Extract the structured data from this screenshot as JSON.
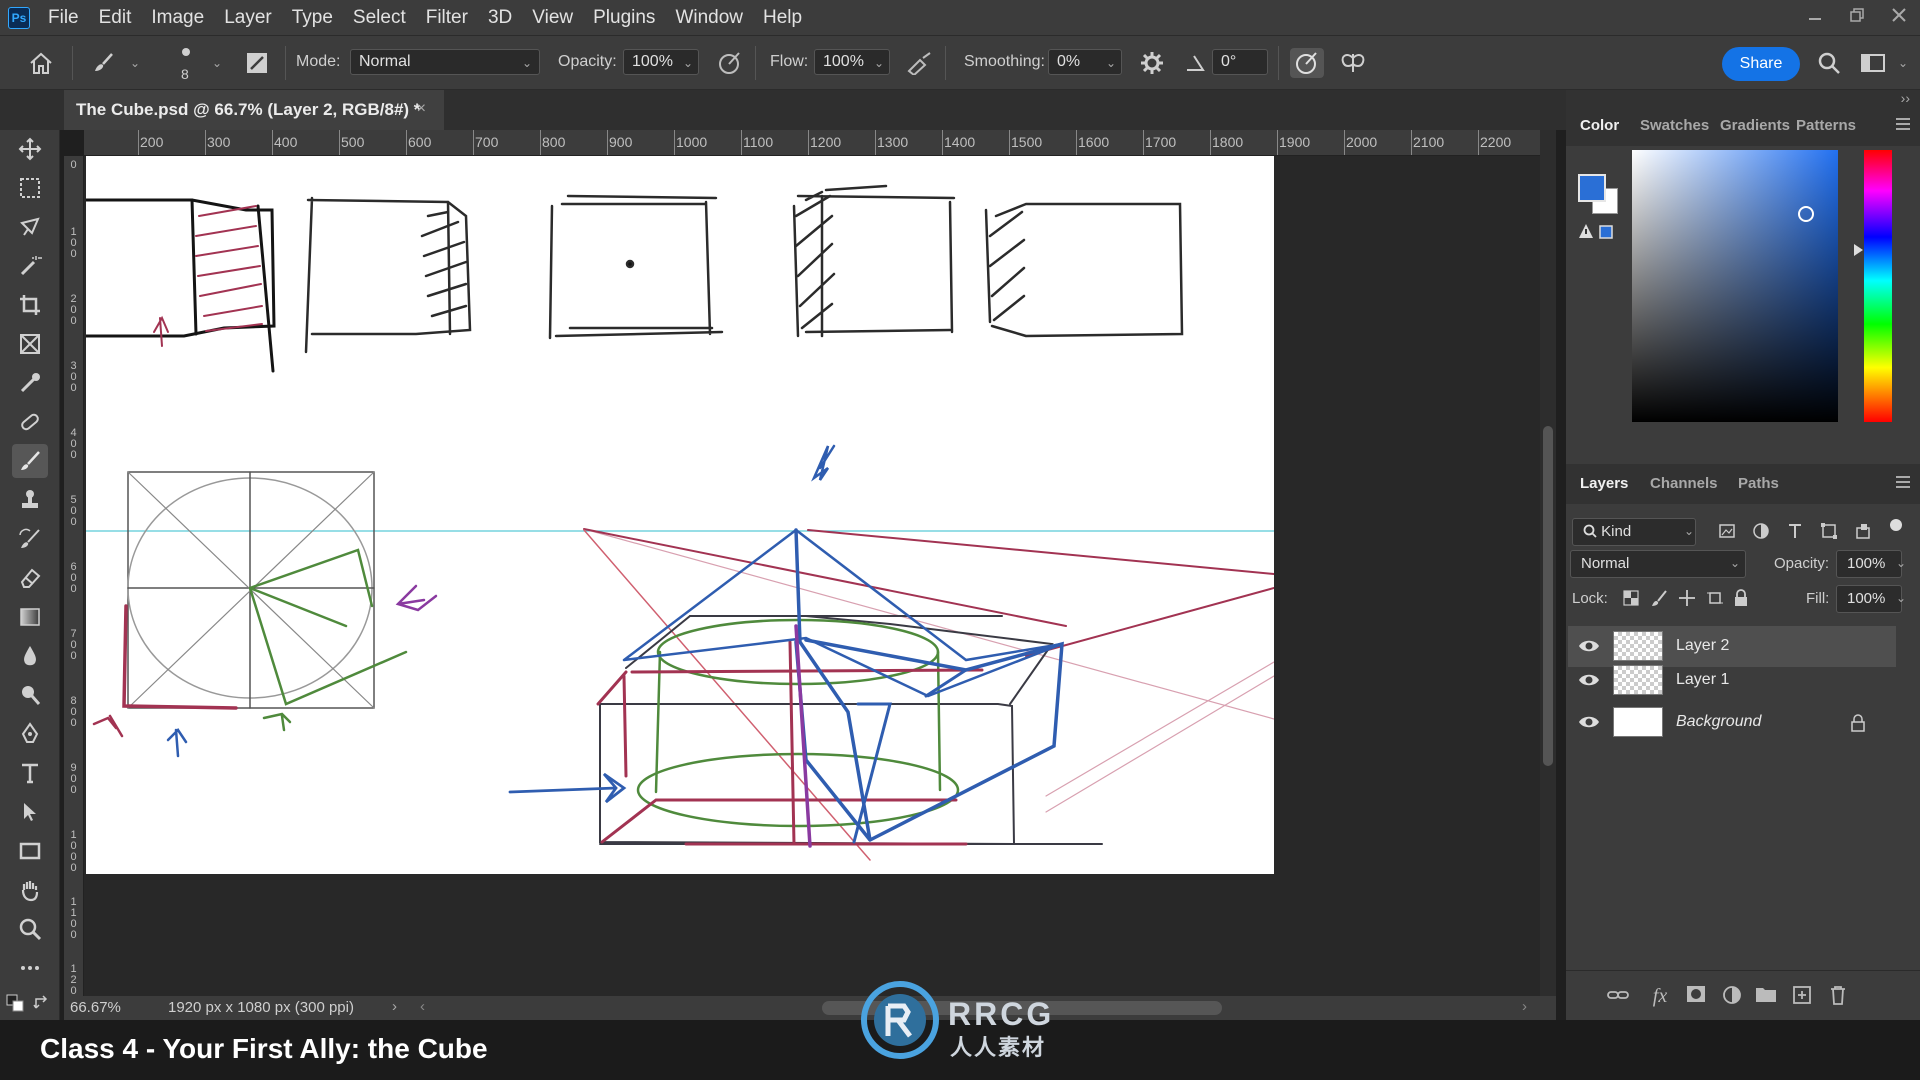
{
  "menubar": {
    "app_logo": "Ps",
    "items": [
      "File",
      "Edit",
      "Image",
      "Layer",
      "Type",
      "Select",
      "Filter",
      "3D",
      "View",
      "Plugins",
      "Window",
      "Help"
    ]
  },
  "options": {
    "brush_size": "8",
    "mode_label": "Mode:",
    "mode_value": "Normal",
    "opacity_label": "Opacity:",
    "opacity_value": "100%",
    "flow_label": "Flow:",
    "flow_value": "100%",
    "smoothing_label": "Smoothing:",
    "smoothing_value": "0%",
    "angle_value": "0°",
    "share_label": "Share"
  },
  "document": {
    "tab_title": "The Cube.psd @ 66.7% (Layer 2, RGB/8#) *",
    "close_glyph": "×",
    "zoom": "66.67%",
    "info": "1920 px x 1080 px (300 ppi)"
  },
  "ruler": {
    "top_labels": [
      "200",
      "300",
      "400",
      "500",
      "600",
      "700",
      "800",
      "900",
      "1000",
      "1100",
      "1200",
      "1300",
      "1400",
      "1500",
      "1600",
      "1700",
      "1800",
      "1900",
      "2000",
      "2100",
      "2200",
      "2"
    ],
    "left_labels": [
      "0",
      "100",
      "200",
      "300",
      "400",
      "500",
      "600",
      "700",
      "800",
      "900",
      "1000",
      "1100",
      "1200"
    ]
  },
  "tools": [
    "move-icon",
    "marquee-icon",
    "lasso-icon",
    "magic-wand-icon",
    "crop-icon",
    "frame-icon",
    "eyedropper-icon",
    "healing-icon",
    "brush-icon",
    "stamp-icon",
    "history-brush-icon",
    "eraser-icon",
    "gradient-icon",
    "blur-icon",
    "dodge-icon",
    "pen-icon",
    "type-icon",
    "path-select-icon",
    "rectangle-icon",
    "hand-icon",
    "zoom-icon",
    "more-icon"
  ],
  "color_panel": {
    "tabs": [
      "Color",
      "Swatches",
      "Gradients",
      "Patterns"
    ],
    "foreground": "#2a6fd6",
    "background": "#ffffff"
  },
  "layers_panel": {
    "tabs": [
      "Layers",
      "Channels",
      "Paths"
    ],
    "filter_kind": "Kind",
    "blend_mode": "Normal",
    "opacity_label": "Opacity:",
    "opacity_value": "100%",
    "lock_label": "Lock:",
    "fill_label": "Fill:",
    "fill_value": "100%",
    "layers": [
      {
        "name": "Layer 2",
        "selected": true
      },
      {
        "name": "Layer 1",
        "selected": false
      },
      {
        "name": "Background",
        "selected": false,
        "locked": true
      }
    ]
  },
  "caption": {
    "title": "Class 4 - Your First Ally: the Cube",
    "watermark_main": "RRCG",
    "watermark_sub": "人人素材"
  },
  "colors": {
    "accent": "#1473e6",
    "sketch_red": "#a23352",
    "sketch_blue": "#2f5db0",
    "sketch_green": "#4f8a3c",
    "sketch_dark": "#3a3236",
    "guide": "#59c9d6"
  }
}
